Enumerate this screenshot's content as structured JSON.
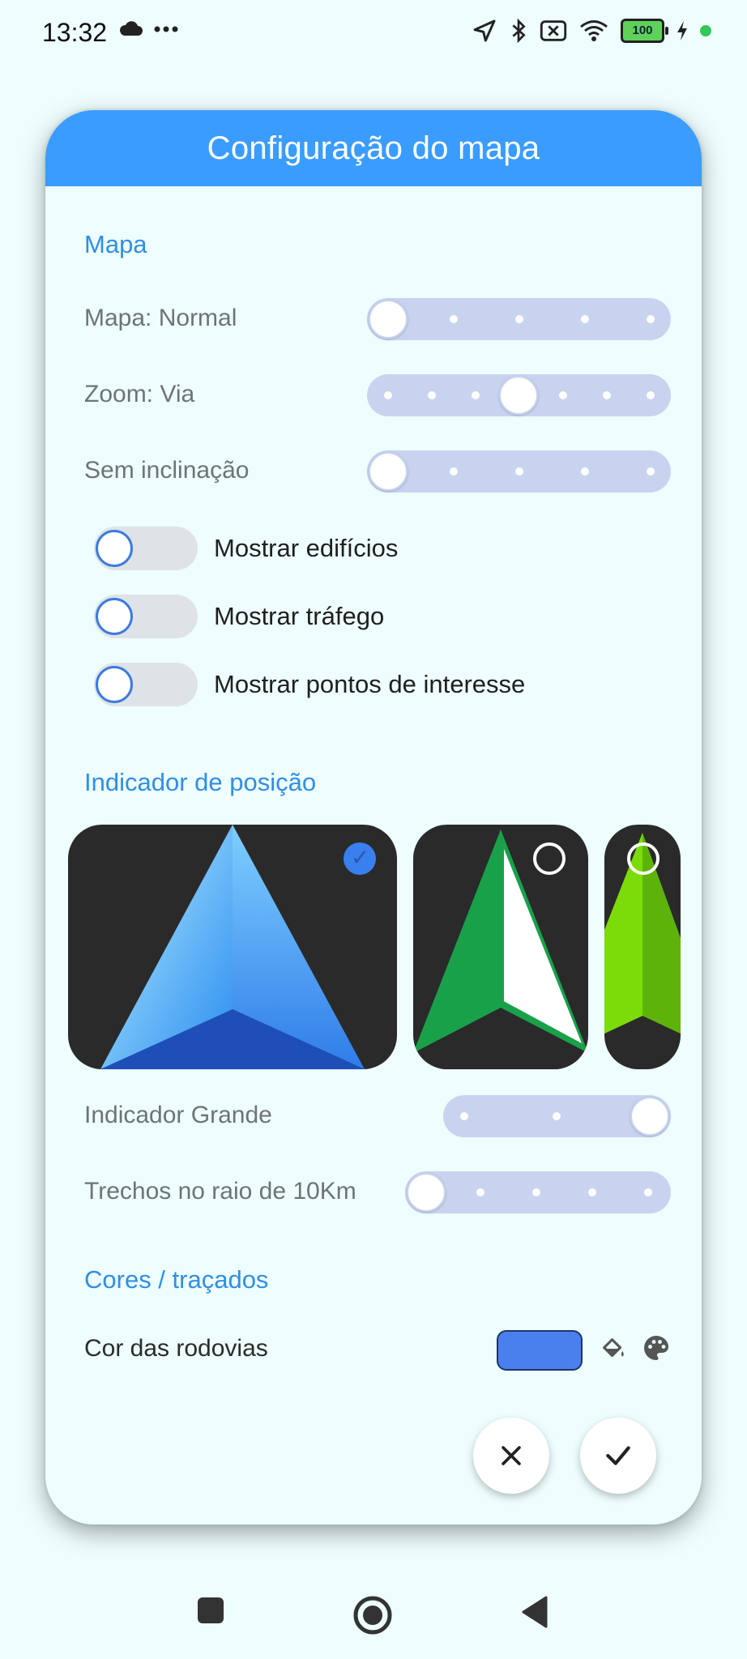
{
  "status_bar": {
    "time": "13:32",
    "left_icons": [
      "cloud-icon",
      "more-dots-icon"
    ],
    "right_icons": [
      "location-arrow-icon",
      "bluetooth-icon",
      "sim-off-icon",
      "wifi-icon",
      "battery-icon",
      "charging-icon"
    ],
    "battery_level": "100"
  },
  "dialog": {
    "title": "Configuração do mapa",
    "sections": {
      "map": "Mapa",
      "position_indicator": "Indicador de posição",
      "colors": "Cores / traçados"
    },
    "map_type": {
      "label": "Mapa: Normal",
      "steps": 5,
      "value_index": 0
    },
    "zoom": {
      "label": "Zoom: Via",
      "steps": 7,
      "value_index": 3
    },
    "tilt": {
      "label": "Sem inclinação",
      "steps": 5,
      "value_index": 0
    },
    "toggles": [
      {
        "label": "Mostrar edifícios",
        "on": false
      },
      {
        "label": "Mostrar tráfego",
        "on": false
      },
      {
        "label": "Mostrar pontos de interesse",
        "on": false
      }
    ],
    "indicators": [
      {
        "name": "blue-arrow",
        "selected": true
      },
      {
        "name": "green-white-arrow",
        "selected": false
      },
      {
        "name": "lime-arrow",
        "selected": false
      }
    ],
    "indicator_size": {
      "label": "Indicador Grande",
      "steps": 3,
      "value_index": 2
    },
    "segments_radius": {
      "label": "Trechos no raio de 10Km",
      "steps": 5,
      "value_index": 0
    },
    "road_color": {
      "label": "Cor das rodovias",
      "color": "#4a80ee",
      "icons": [
        "paint-bucket-icon",
        "palette-icon"
      ]
    },
    "actions": {
      "cancel_icon": "close-icon",
      "confirm_icon": "check-icon"
    }
  },
  "nav_bar": {
    "icons": [
      "recents-square-icon",
      "home-circle-icon",
      "back-triangle-icon"
    ]
  },
  "colors": {
    "accent": "#3a9cff",
    "section_title": "#2f8fe6",
    "background": "#eefdfd",
    "slider_track": "#c8d4ef"
  }
}
